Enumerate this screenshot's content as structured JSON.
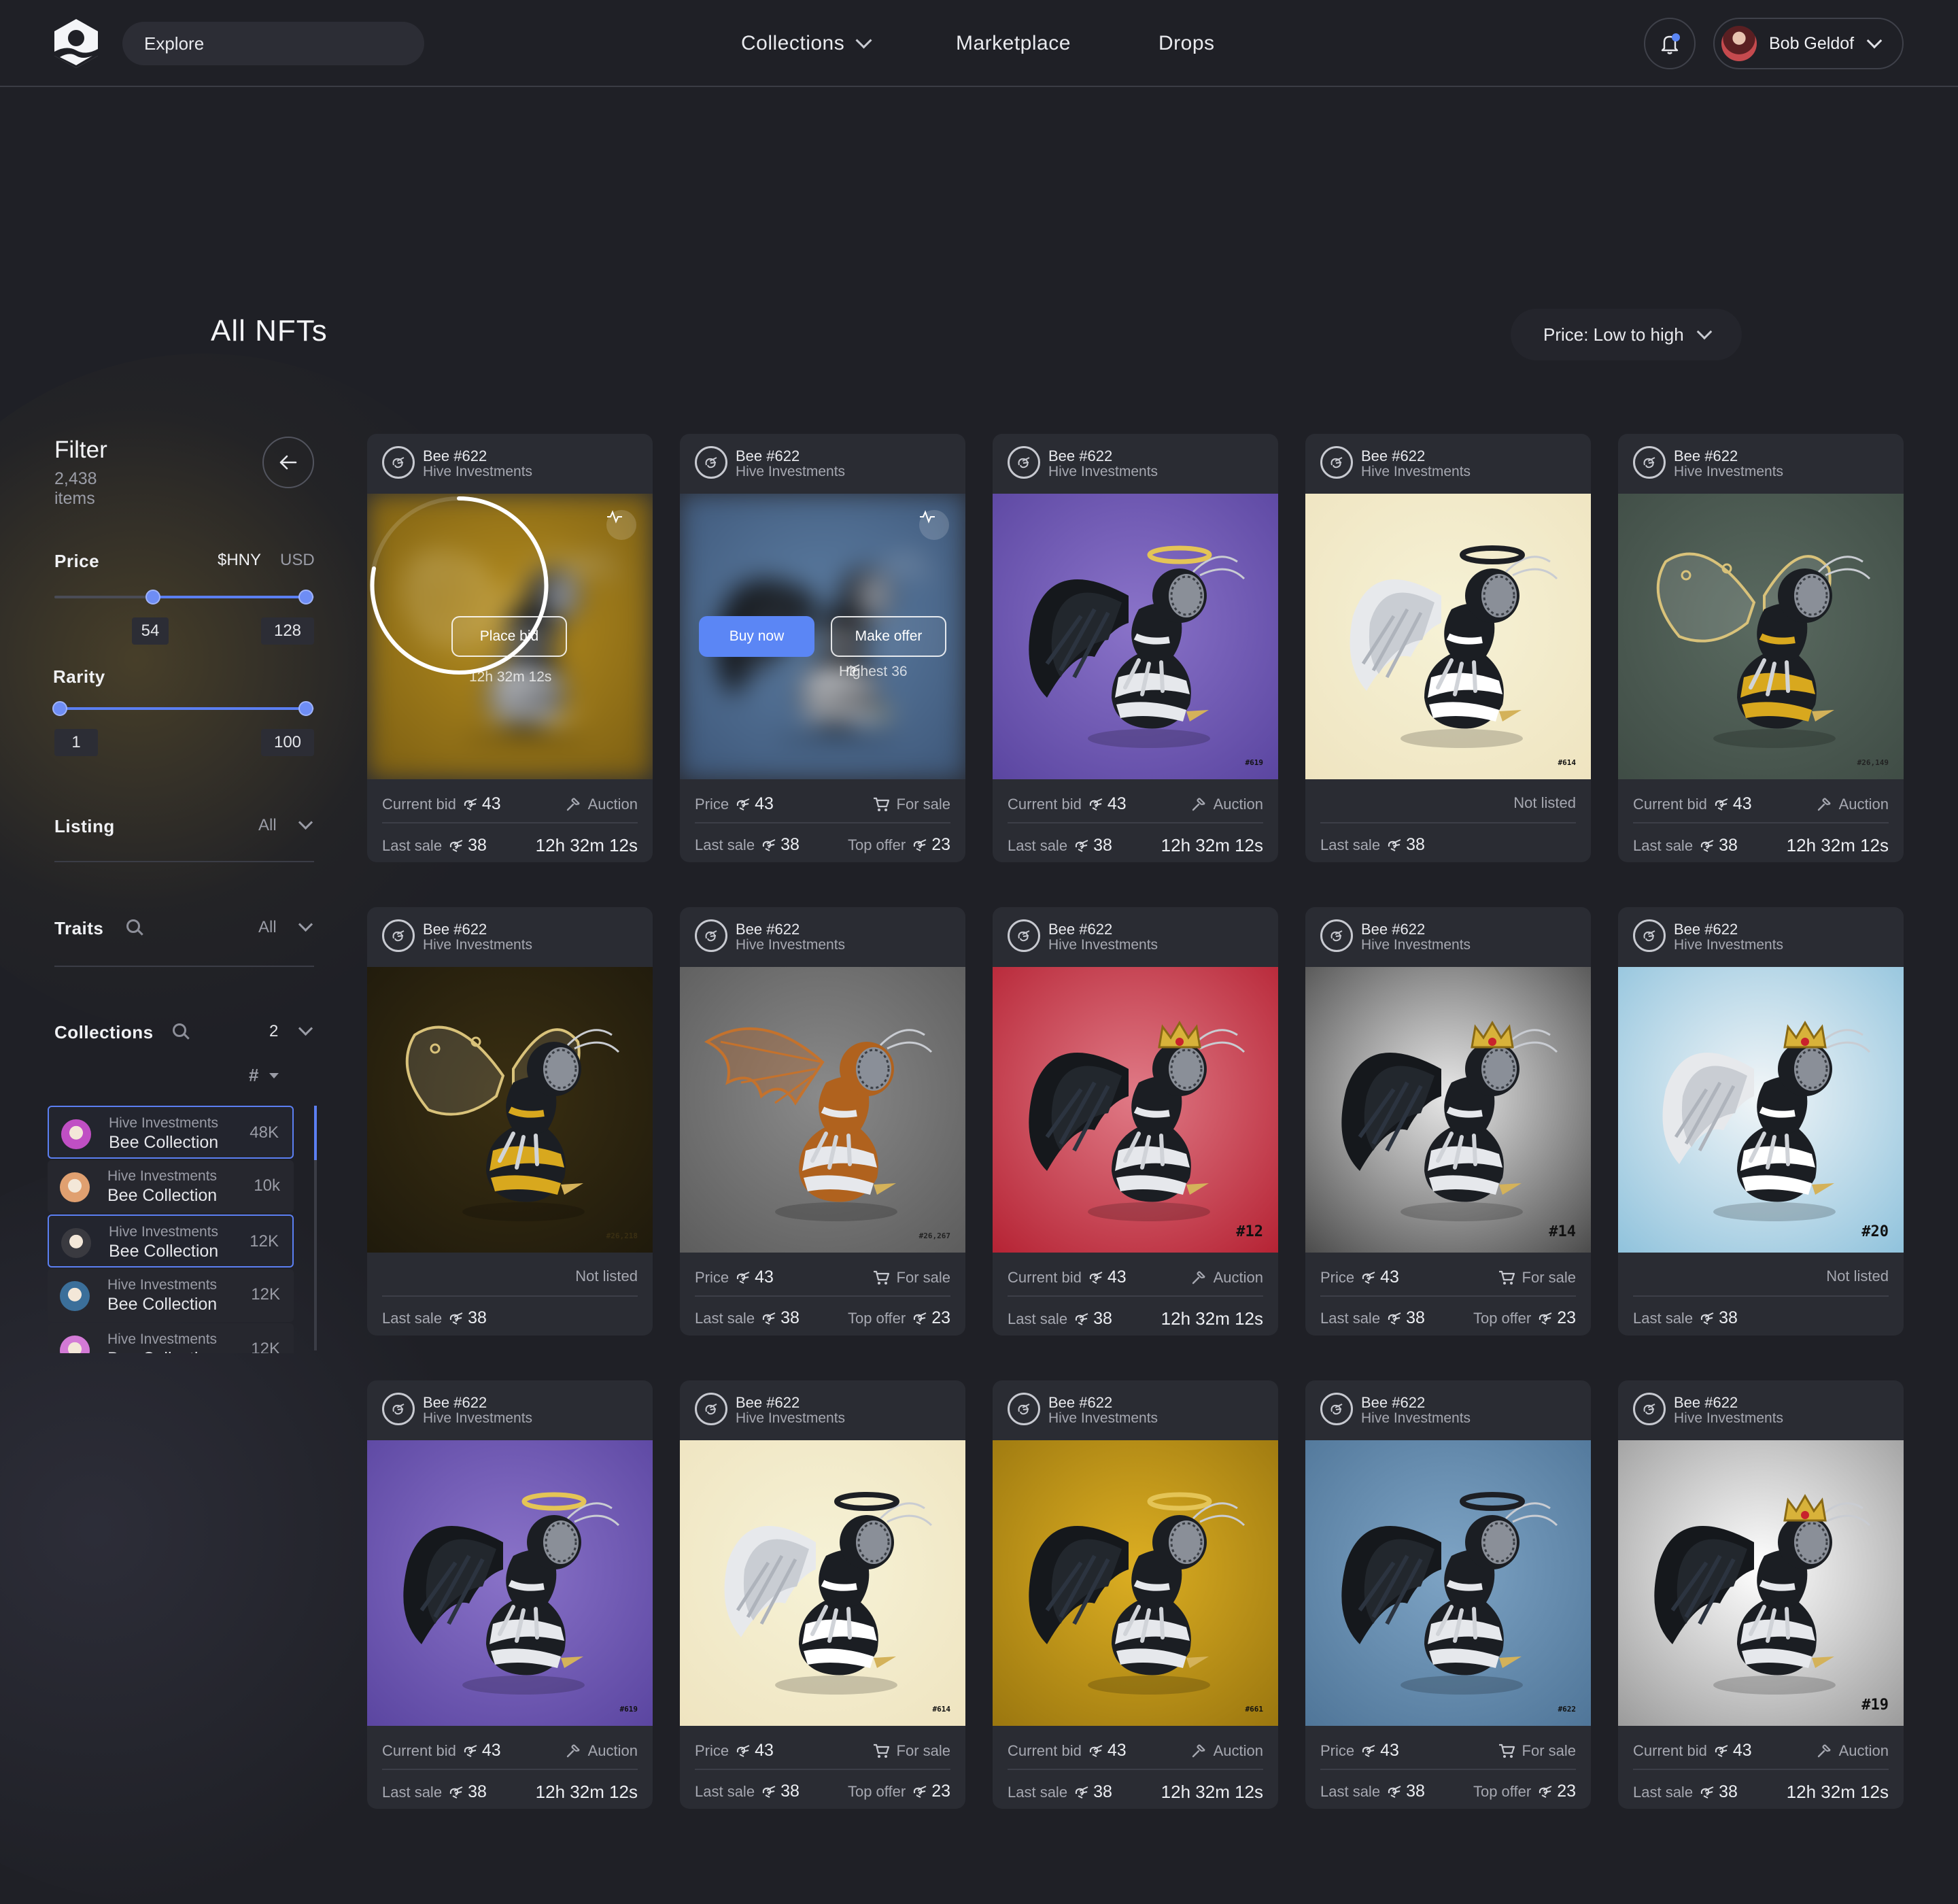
{
  "header": {
    "search_placeholder": "Explore",
    "nav": [
      "Collections",
      "Marketplace",
      "Drops"
    ],
    "user_name": "Bob Geldof"
  },
  "page": {
    "title": "All NFTs",
    "sort_label": "Price: Low to high"
  },
  "filter": {
    "title": "Filter",
    "count": "2,438 items",
    "price_label": "Price",
    "currency_a": "$HNY",
    "currency_b": "USD",
    "price_min": "54",
    "price_max": "128",
    "rarity_label": "Rarity",
    "rarity_min": "1",
    "rarity_max": "100",
    "listing_label": "Listing",
    "listing_value": "All",
    "traits_label": "Traits",
    "traits_value": "All",
    "collections_label": "Collections",
    "collections_value": "2",
    "sort_hash": "#",
    "collections": [
      {
        "owner": "Hive Investments",
        "name": "Bee Collection",
        "count": "48K",
        "selected": true,
        "color": "#c04fc4"
      },
      {
        "owner": "Hive Investments",
        "name": "Bee Collection",
        "count": "10k",
        "selected": false,
        "color": "#e0a070"
      },
      {
        "owner": "Hive Investments",
        "name": "Bee Collection",
        "count": "12K",
        "selected": true,
        "color": "#3a3a40"
      },
      {
        "owner": "Hive Investments",
        "name": "Bee Collection",
        "count": "12K",
        "selected": false,
        "color": "#3b6f9a"
      },
      {
        "owner": "Hive Investments",
        "name": "Bee Collection",
        "count": "12K",
        "selected": false,
        "color": "#d37ad6"
      }
    ]
  },
  "overlay": {
    "place_bid": "Place bid",
    "timer": "12h 32m 12s",
    "buy_now": "Buy now",
    "make_offer": "Make offer",
    "highest_label": "Highest",
    "highest_value": "36"
  },
  "cards": [
    {
      "name": "Bee #622",
      "collection": "Hive Investments",
      "bg": [
        "#b58d1f",
        "#7a5d12"
      ],
      "wing": "clear",
      "tag": "",
      "tagColor": "#000",
      "kind": "auction",
      "primary_label": "Current bid",
      "primary_value": "43",
      "status": "Auction",
      "last_label": "Last sale",
      "last_value": "38",
      "right_text": "12h 32m 12s",
      "right_label": "",
      "right_value": "",
      "overlay": "bid"
    },
    {
      "name": "Bee #622",
      "collection": "Hive Investments",
      "bg": [
        "#5d7ea3",
        "#3d5678"
      ],
      "wing": "black",
      "tag": "",
      "tagColor": "#000",
      "kind": "sale",
      "primary_label": "Price",
      "primary_value": "43",
      "status": "For sale",
      "last_label": "Last sale",
      "last_value": "38",
      "right_text": "",
      "right_label": "Top offer",
      "right_value": "23",
      "overlay": "buy"
    },
    {
      "name": "Bee #622",
      "collection": "Hive Investments",
      "bg": [
        "#8a73c9",
        "#5a45a0"
      ],
      "wing": "black",
      "tag": "#619",
      "tagColor": "#111",
      "kind": "auction",
      "primary_label": "Current bid",
      "primary_value": "43",
      "status": "Auction",
      "last_label": "Last sale",
      "last_value": "38",
      "right_text": "12h 32m 12s",
      "right_label": "",
      "right_value": "",
      "overlay": ""
    },
    {
      "name": "Bee #622",
      "collection": "Hive Investments",
      "bg": [
        "#f6f2d6",
        "#efe4c0"
      ],
      "wing": "white",
      "tag": "#614",
      "tagColor": "#111",
      "kind": "none",
      "primary_label": "",
      "primary_value": "",
      "status": "Not listed",
      "last_label": "Last sale",
      "last_value": "38",
      "right_text": "",
      "right_label": "",
      "right_value": "",
      "overlay": ""
    },
    {
      "name": "Bee #622",
      "collection": "Hive Investments",
      "bg": [
        "#5a6a60",
        "#3f4c45"
      ],
      "wing": "clear",
      "tag": "#26,149",
      "tagColor": "#222",
      "kind": "auction",
      "primary_label": "Current bid",
      "primary_value": "43",
      "status": "Auction",
      "last_label": "Last sale",
      "last_value": "38",
      "right_text": "12h 32m 12s",
      "right_label": "",
      "right_value": "",
      "overlay": ""
    },
    {
      "name": "Bee #622",
      "collection": "Hive Investments",
      "bg": [
        "#3a2f12",
        "#1f1a0c"
      ],
      "wing": "clear",
      "tag": "#26,218",
      "tagColor": "#3a2f12",
      "kind": "none",
      "primary_label": "",
      "primary_value": "",
      "status": "Not listed",
      "last_label": "Last sale",
      "last_value": "38",
      "right_text": "",
      "right_label": "",
      "right_value": "",
      "overlay": ""
    },
    {
      "name": "Bee #622",
      "collection": "Hive Investments",
      "bg": [
        "#8a8a8a",
        "#5c5c5c"
      ],
      "wing": "bat",
      "tag": "#26,267",
      "tagColor": "#222",
      "kind": "sale",
      "primary_label": "Price",
      "primary_value": "43",
      "status": "For sale",
      "last_label": "Last sale",
      "last_value": "38",
      "right_text": "",
      "right_label": "Top offer",
      "right_value": "23",
      "overlay": ""
    },
    {
      "name": "Bee #622",
      "collection": "Hive Investments",
      "bg": [
        "#e07a86",
        "#b52233"
      ],
      "wing": "black",
      "tag": "#12",
      "tagColor": "#111",
      "kind": "auction",
      "primary_label": "Current bid",
      "primary_value": "43",
      "status": "Auction",
      "last_label": "Last sale",
      "last_value": "38",
      "right_text": "12h 32m 12s",
      "right_label": "",
      "right_value": "",
      "overlay": ""
    },
    {
      "name": "Bee #622",
      "collection": "Hive Investments",
      "bg": [
        "#e8e8e8",
        "#4a4a4a"
      ],
      "wing": "black",
      "tag": "#14",
      "tagColor": "#111",
      "kind": "sale",
      "primary_label": "Price",
      "primary_value": "43",
      "status": "For sale",
      "last_label": "Last sale",
      "last_value": "38",
      "right_text": "",
      "right_label": "Top offer",
      "right_value": "23",
      "overlay": ""
    },
    {
      "name": "Bee #622",
      "collection": "Hive Investments",
      "bg": [
        "#f2f6f8",
        "#8fc2dc"
      ],
      "wing": "white",
      "tag": "#20",
      "tagColor": "#111",
      "kind": "none",
      "primary_label": "",
      "primary_value": "",
      "status": "Not listed",
      "last_label": "Last sale",
      "last_value": "38",
      "right_text": "",
      "right_label": "",
      "right_value": "",
      "overlay": ""
    },
    {
      "name": "Bee #622",
      "collection": "Hive Investments",
      "bg": [
        "#8a73c9",
        "#5a45a0"
      ],
      "wing": "black",
      "tag": "#619",
      "tagColor": "#111",
      "kind": "auction",
      "primary_label": "Current bid",
      "primary_value": "43",
      "status": "Auction",
      "last_label": "Last sale",
      "last_value": "38",
      "right_text": "12h 32m 12s",
      "right_label": "",
      "right_value": "",
      "overlay": ""
    },
    {
      "name": "Bee #622",
      "collection": "Hive Investments",
      "bg": [
        "#f6f2d6",
        "#efe4c0"
      ],
      "wing": "white",
      "tag": "#614",
      "tagColor": "#111",
      "kind": "sale",
      "primary_label": "Price",
      "primary_value": "43",
      "status": "For sale",
      "last_label": "Last sale",
      "last_value": "38",
      "right_text": "",
      "right_label": "Top offer",
      "right_value": "23",
      "overlay": ""
    },
    {
      "name": "Bee #622",
      "collection": "Hive Investments",
      "bg": [
        "#dcae22",
        "#9a760f"
      ],
      "wing": "black",
      "tag": "#661",
      "tagColor": "#111",
      "kind": "auction",
      "primary_label": "Current bid",
      "primary_value": "43",
      "status": "Auction",
      "last_label": "Last sale",
      "last_value": "38",
      "right_text": "12h 32m 12s",
      "right_label": "",
      "right_value": "",
      "overlay": ""
    },
    {
      "name": "Bee #622",
      "collection": "Hive Investments",
      "bg": [
        "#7ea4c5",
        "#4f7598"
      ],
      "wing": "black",
      "tag": "#622",
      "tagColor": "#111",
      "kind": "sale",
      "primary_label": "Price",
      "primary_value": "43",
      "status": "For sale",
      "last_label": "Last sale",
      "last_value": "38",
      "right_text": "",
      "right_label": "Top offer",
      "right_value": "23",
      "overlay": ""
    },
    {
      "name": "Bee #622",
      "collection": "Hive Investments",
      "bg": [
        "#ffffff",
        "#9a9a9a"
      ],
      "wing": "black",
      "tag": "#19",
      "tagColor": "#111",
      "kind": "auction",
      "primary_label": "Current bid",
      "primary_value": "43",
      "status": "Auction",
      "last_label": "Last sale",
      "last_value": "38",
      "right_text": "12h 32m 12s",
      "right_label": "",
      "right_value": "",
      "overlay": ""
    }
  ]
}
